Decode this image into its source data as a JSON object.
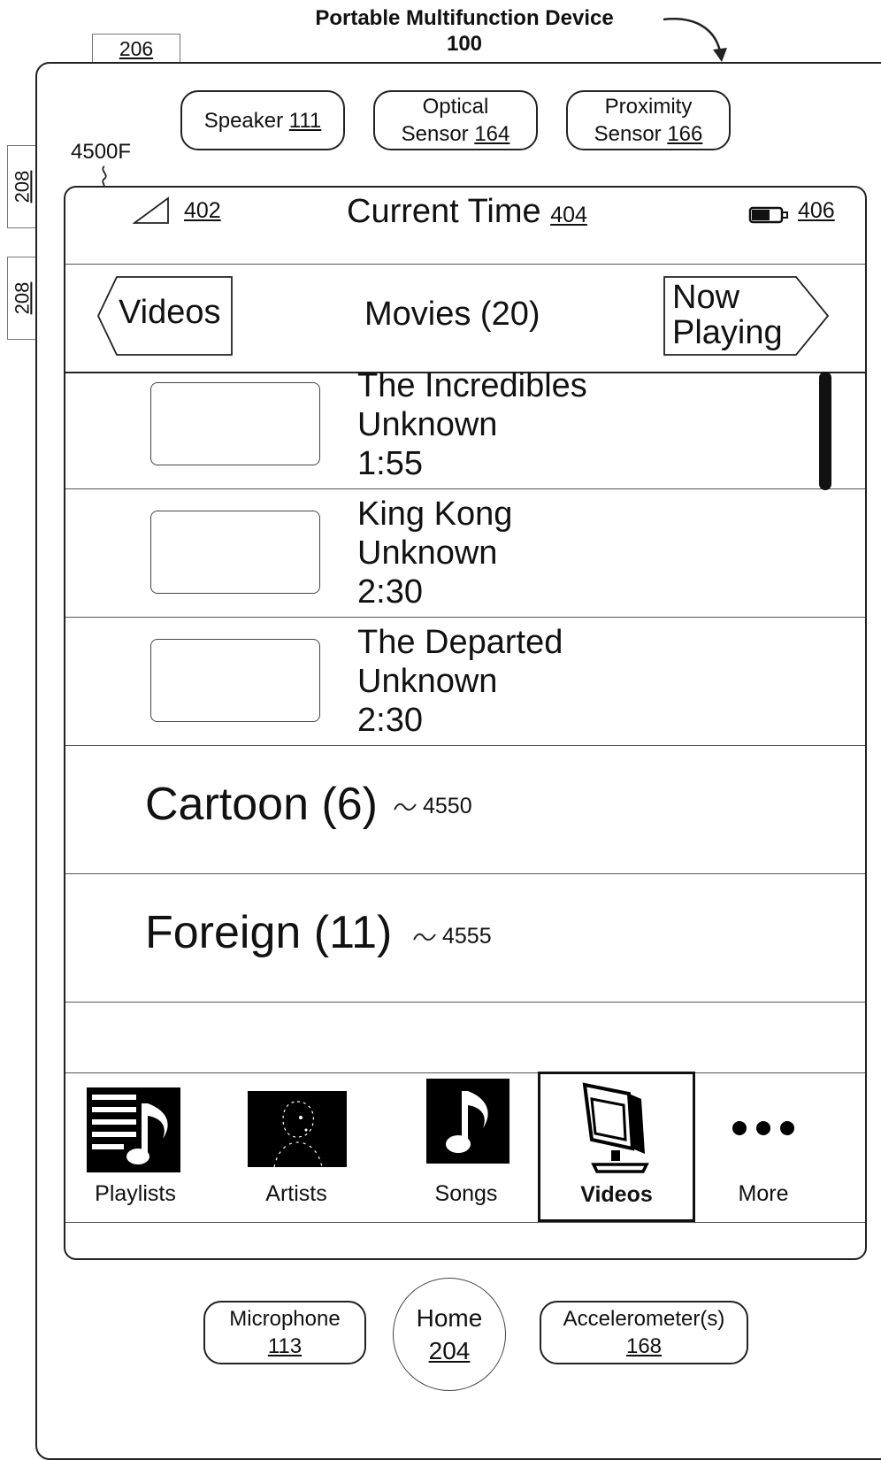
{
  "figure": {
    "title_line1": "Portable Multifunction Device",
    "title_line2": "100",
    "label_206": "206",
    "label_208_a": "208",
    "label_208_b": "208",
    "label_screen": "4500F"
  },
  "sensors": {
    "speaker_text": "Speaker",
    "speaker_num": "111",
    "optical_line1": "Optical",
    "optical_text": "Sensor",
    "optical_num": "164",
    "proximity_line1": "Proximity",
    "proximity_text": "Sensor",
    "proximity_num": "166"
  },
  "status_bar": {
    "signal_num": "402",
    "time_text": "Current Time",
    "time_num": "404",
    "battery_num": "406"
  },
  "nav_bar": {
    "back_label": "Videos",
    "title": "Movies (20)",
    "forward_line1": "Now",
    "forward_line2": "Playing"
  },
  "movies": [
    {
      "title": "The Incredibles",
      "artist": "Unknown",
      "duration": "1:55"
    },
    {
      "title": "King Kong",
      "artist": "Unknown",
      "duration": "2:30"
    },
    {
      "title": "The Departed",
      "artist": "Unknown",
      "duration": "2:30"
    }
  ],
  "categories": [
    {
      "label": "Cartoon (6)",
      "ref": "4550"
    },
    {
      "label": "Foreign (11)",
      "ref": "4555"
    }
  ],
  "tab_bar": {
    "tabs": [
      {
        "label": "Playlists",
        "icon": "playlists-icon"
      },
      {
        "label": "Artists",
        "icon": "artists-icon"
      },
      {
        "label": "Songs",
        "icon": "songs-icon"
      },
      {
        "label": "Videos",
        "icon": "videos-icon",
        "selected": true
      },
      {
        "label": "More",
        "icon": "more-icon"
      }
    ]
  },
  "hardware": {
    "microphone_text": "Microphone",
    "microphone_num": "113",
    "home_text": "Home",
    "home_num": "204",
    "accelerometer_text": "Accelerometer(s)",
    "accelerometer_num": "168"
  },
  "colors": {
    "line": "#222222",
    "icon_fill": "#000000",
    "background": "#ffffff"
  }
}
